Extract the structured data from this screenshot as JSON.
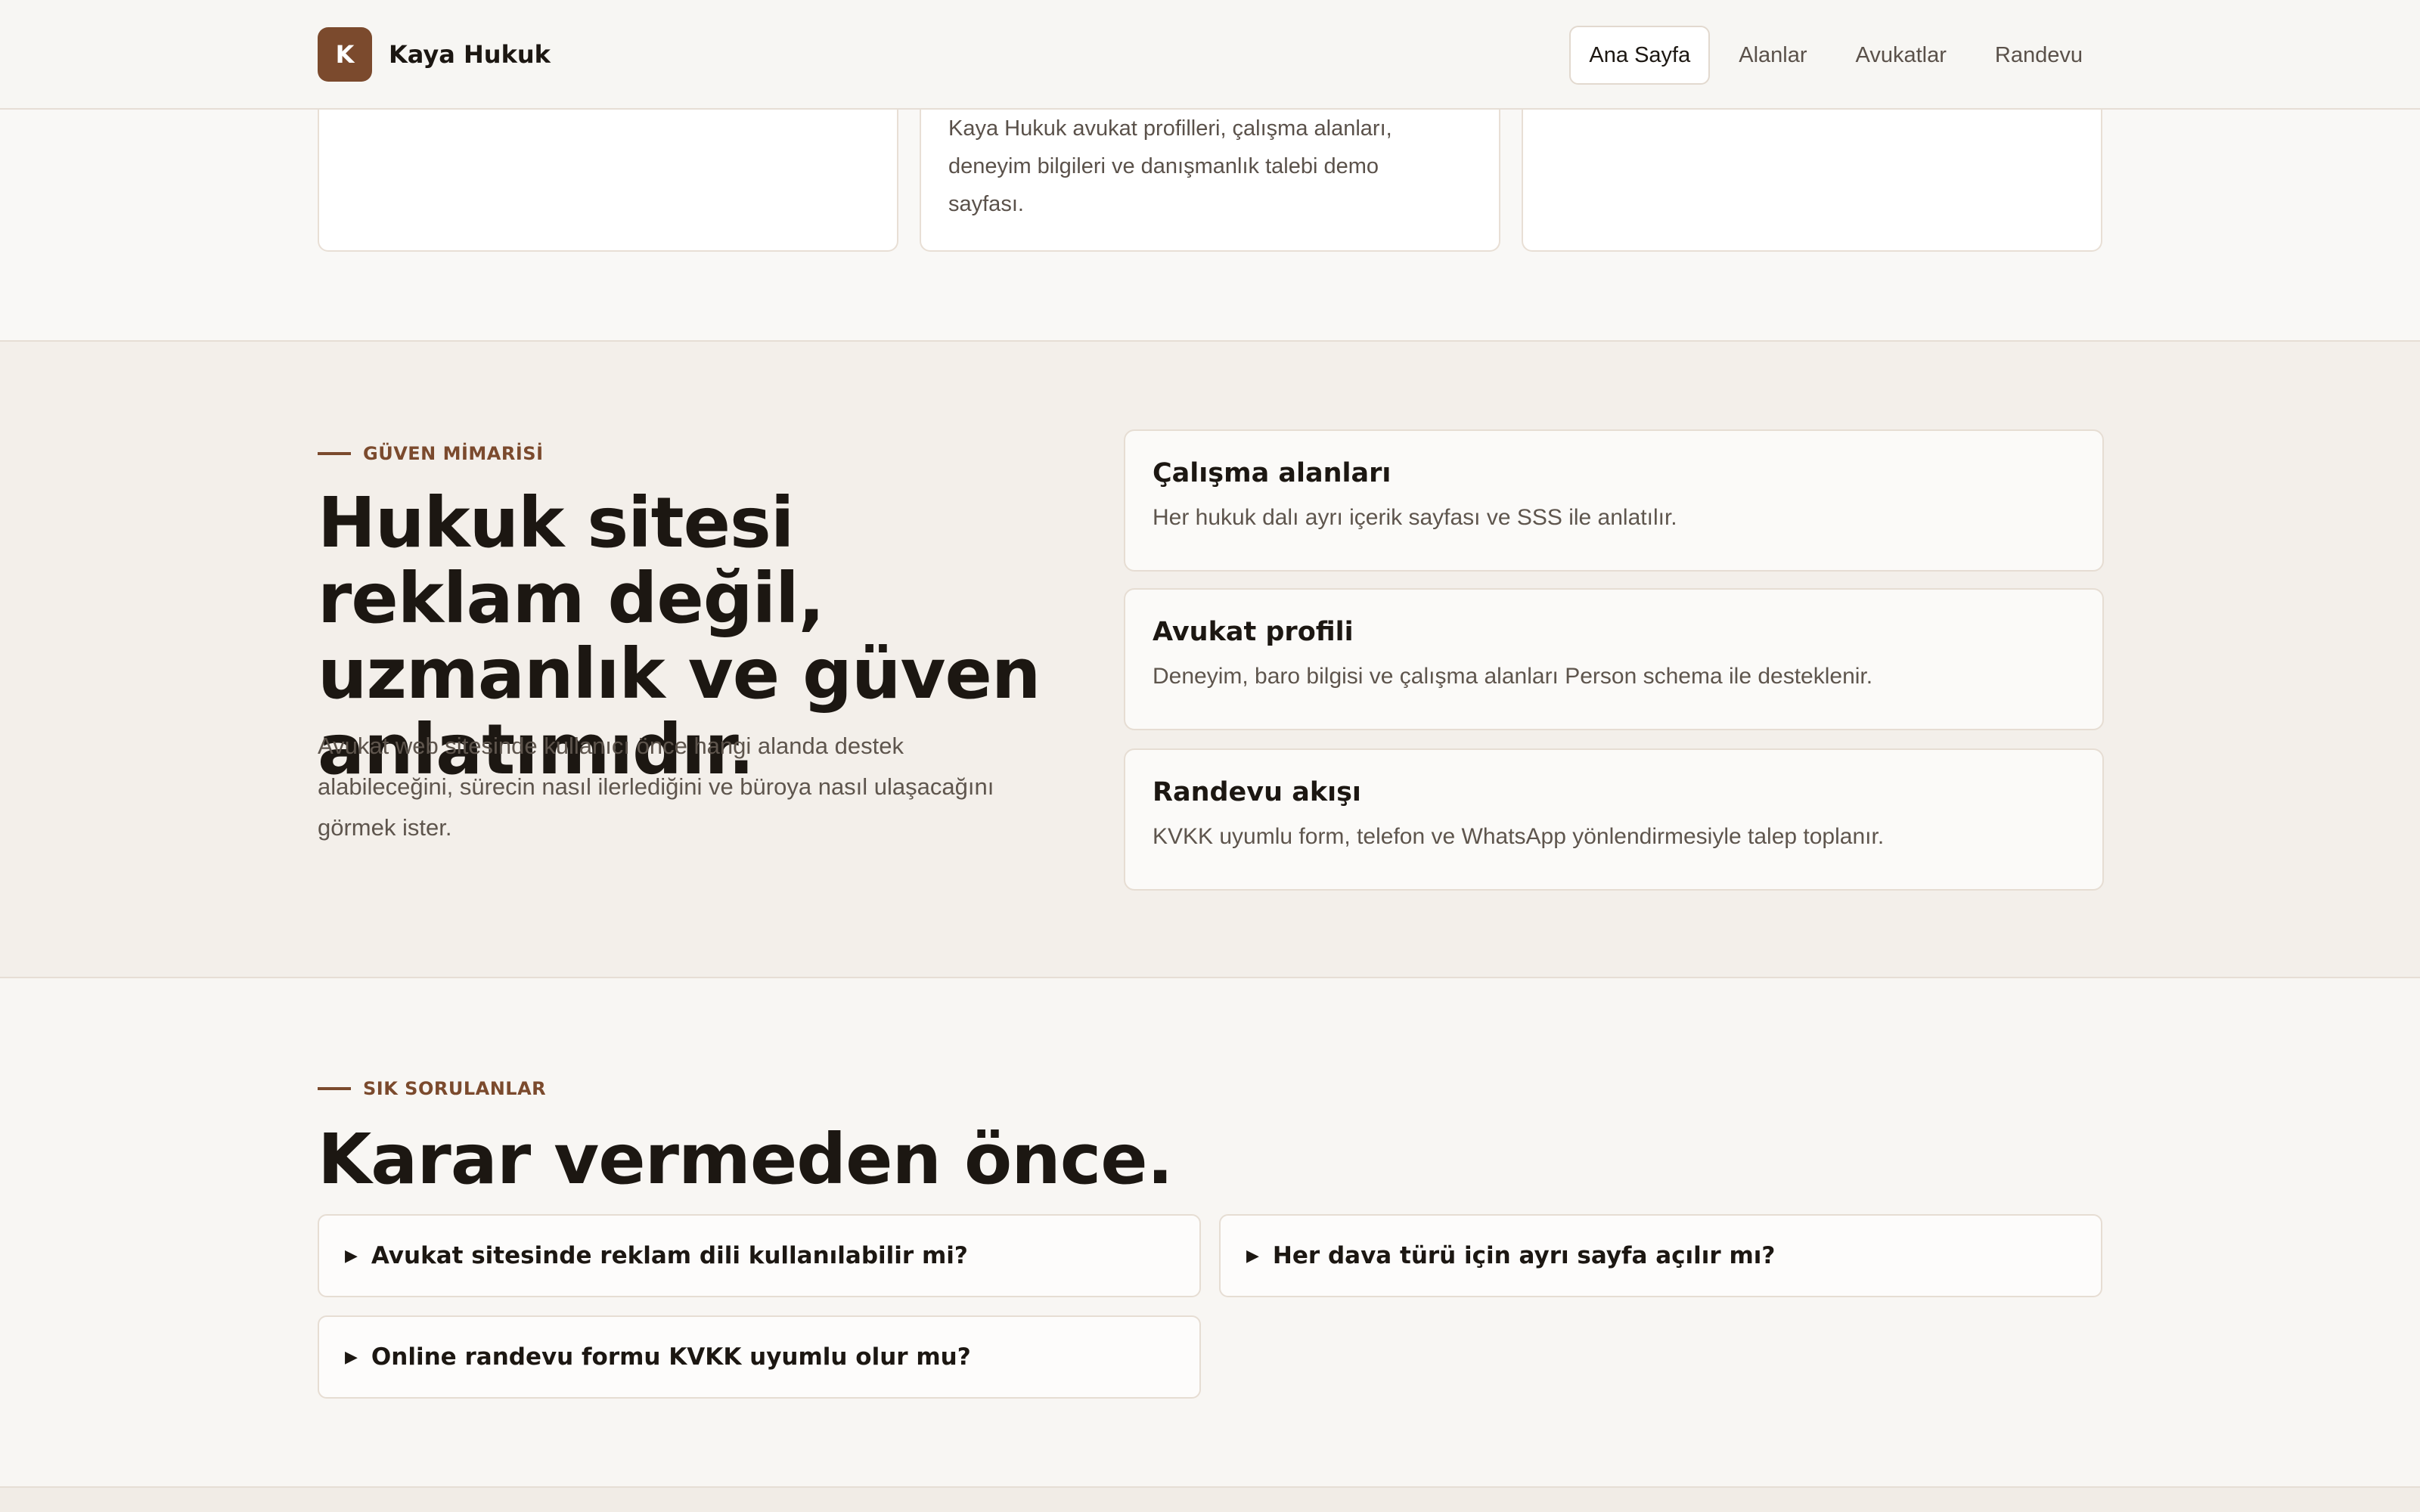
{
  "header": {
    "logo_letter": "K",
    "brand": "Kaya Hukuk",
    "nav": [
      {
        "label": "Ana Sayfa",
        "active": true
      },
      {
        "label": "Alanlar",
        "active": false
      },
      {
        "label": "Avukatlar",
        "active": false
      },
      {
        "label": "Randevu",
        "active": false
      }
    ]
  },
  "top_cards": {
    "middle_text": "Kaya Hukuk avukat profilleri, çalışma alanları, deneyim bilgileri ve danışmanlık talebi demo sayfası."
  },
  "trust": {
    "eyebrow": "GÜVEN MİMARİSİ",
    "title": "Hukuk sitesi reklam değil, uzmanlık ve güven anlatımıdır.",
    "description": "Avukat web sitesinde kullanıcı önce hangi alanda destek alabileceğini, sürecin nasıl ilerlediğini ve büroya nasıl ulaşacağını görmek ister.",
    "features": [
      {
        "title": "Çalışma alanları",
        "desc": "Her hukuk dalı ayrı içerik sayfası ve SSS ile anlatılır."
      },
      {
        "title": "Avukat profili",
        "desc": "Deneyim, baro bilgisi ve çalışma alanları Person schema ile desteklenir."
      },
      {
        "title": "Randevu akışı",
        "desc": "KVKK uyumlu form, telefon ve WhatsApp yönlendirmesiyle talep toplanır."
      }
    ]
  },
  "faq": {
    "eyebrow": "SIK SORULANLAR",
    "title": "Karar vermeden önce.",
    "questions": [
      "Avukat sitesinde reklam dili kullanılabilir mi?",
      "Her dava türü için ayrı sayfa açılır mı?",
      "Online randevu formu KVKK uyumlu olur mu?"
    ]
  },
  "colors": {
    "accent": "#7b4a2d",
    "text": "#1c1712",
    "muted": "#5e554d",
    "border": "#e6ddd3"
  }
}
